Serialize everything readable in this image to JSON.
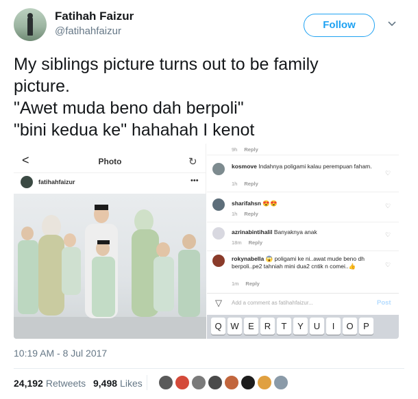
{
  "author": {
    "name": "Fatihah Faizur",
    "handle": "@fatihahfaizur",
    "follow_label": "Follow"
  },
  "tweet": {
    "lines": [
      "My siblings picture turns out to be family",
      "picture.",
      "\"Awet muda beno dah berpoli\"",
      "\"bini kedua ke\" hahahah I kenot"
    ],
    "timestamp": "10:19 AM - 8 Jul 2017"
  },
  "media_left": {
    "title": "Photo",
    "username": "fatihahfaizur",
    "back_glyph": "<",
    "refresh_glyph": "↻",
    "dots_glyph": "•••",
    "photo_label": ""
  },
  "media_right": {
    "top_meta": {
      "time": "9h",
      "reply": "Reply"
    },
    "comments": [
      {
        "user": "kosmove",
        "text": "Indahnya poligami kalau perempuan faham.",
        "time": "1h",
        "reply": "Reply",
        "avatar_color": "#7d8b8f"
      },
      {
        "user": "sharifahsn",
        "text": "😍😍",
        "time": "1h",
        "reply": "Reply",
        "avatar_color": "#5d6e7a"
      },
      {
        "user": "azrinabintihalil",
        "text": "Banyaknya anak",
        "time": "18m",
        "reply": "Reply",
        "avatar_color": "#d8d8e0"
      },
      {
        "user": "rokynabella",
        "text": "😱 poligami ke ni..awat mude beno dh berpoli..pe2 tahniah mini dua2 cntik n comei..👍",
        "time": "1m",
        "reply": "Reply",
        "avatar_color": "#8a3b2a"
      }
    ],
    "add_placeholder": "Add a comment as fatihahfaizur...",
    "post_label": "Post",
    "keys": [
      "Q",
      "W",
      "E",
      "R",
      "T",
      "Y",
      "U",
      "I",
      "O",
      "P"
    ]
  },
  "engagement": {
    "retweets_count": "24,192",
    "retweets_label": "Retweets",
    "likes_count": "9,498",
    "likes_label": "Likes",
    "likers": [
      "#5a5a5a",
      "#d44a3a",
      "#7a7a7a",
      "#4a4a4a",
      "#c2663d",
      "#1d1d1d",
      "#e0a040",
      "#8a9aa8"
    ]
  },
  "colors": {
    "accent": "#1da1f2",
    "muted": "#657786"
  }
}
